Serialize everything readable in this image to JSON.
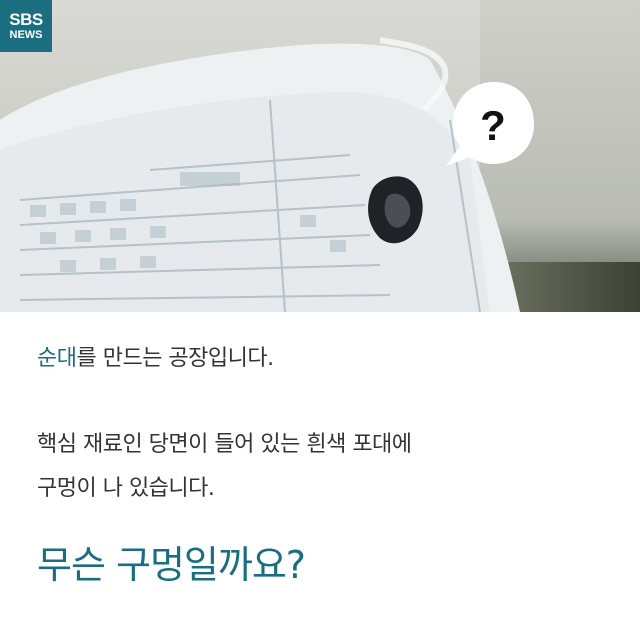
{
  "brand": {
    "logo_line1": "SBS",
    "logo_line2": "NEWS",
    "accent_color": "#1a6e80"
  },
  "photo": {
    "description_icon": "bag-with-hole",
    "bubble_text": "?"
  },
  "text": {
    "line1_accent": "순대",
    "line1_rest": "를 만드는 공장입니다.",
    "line2": "핵심 재료인 당면이 들어 있는 흰색 포대에",
    "line3": "구멍이 나 있습니다.",
    "question": "무슨 구멍일까요?"
  }
}
